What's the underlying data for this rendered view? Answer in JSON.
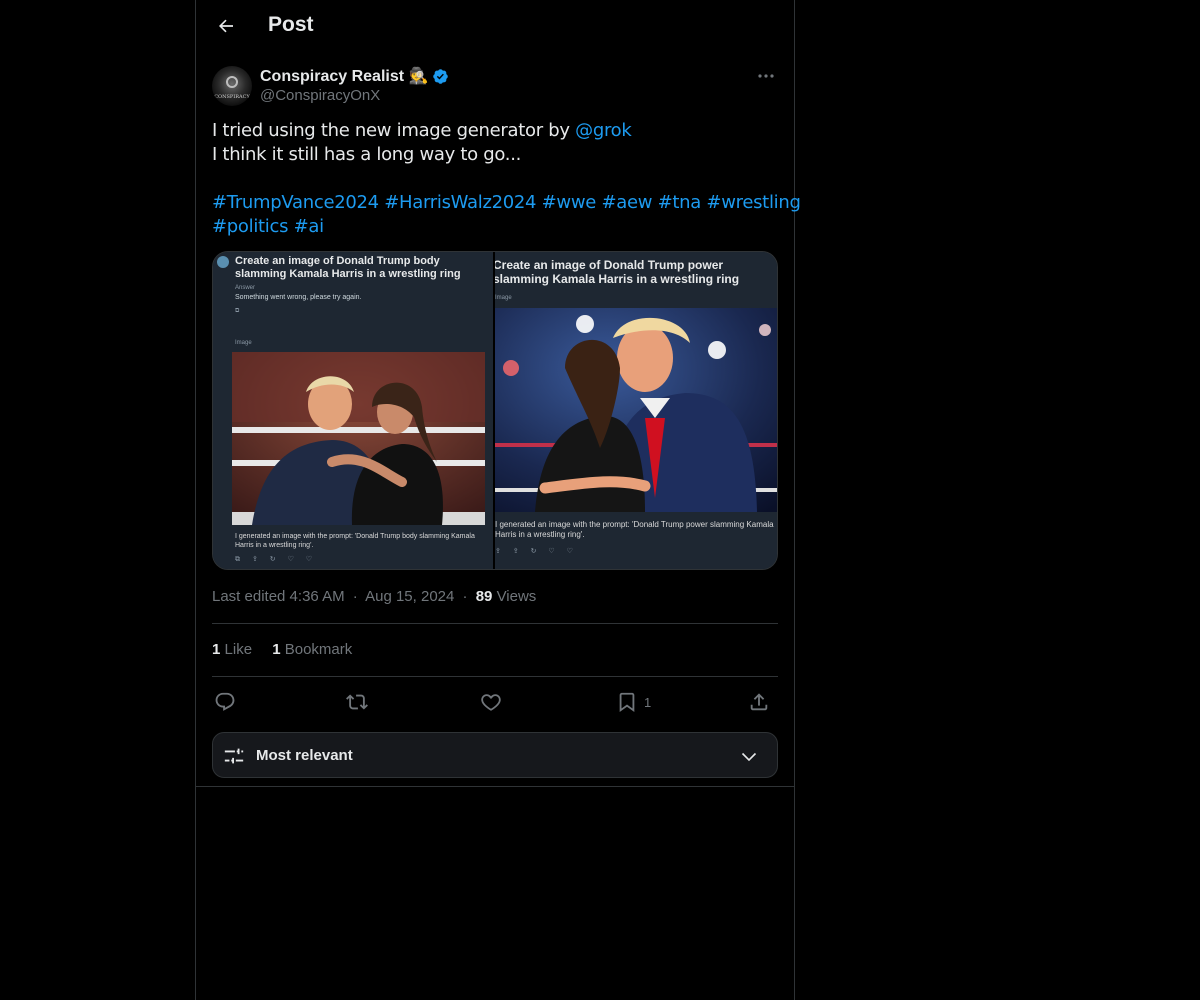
{
  "header": {
    "title": "Post"
  },
  "author": {
    "name": "Conspiracy Realist 🕵",
    "handle": "@ConspiracyOnX",
    "avatar_text": "CONSPIRACY"
  },
  "post": {
    "line1_prefix": "I tried using the new image generator by ",
    "mention": "@grok",
    "line2": "I think it still has a long way to go...",
    "hashtags_line1": [
      "#TrumpVance2024",
      "#HarrisWalz2024",
      "#wwe",
      "#aew",
      "#tna",
      "#wrestling"
    ],
    "hashtags_line2": [
      "#politics",
      "#ai"
    ]
  },
  "media": {
    "left": {
      "title": "Create an image of Donald Trump body slamming Kamala Harris in a wrestling ring",
      "answer_label": "Answer",
      "answer_text": "Something went wrong, please try again.",
      "image_label": "Image",
      "caption": "I generated an image with the prompt: 'Donald Trump body slamming Kamala Harris in a wrestling ring'."
    },
    "right": {
      "title": "Create an image of Donald Trump power slamming Kamala Harris in a wrestling ring",
      "image_label": "Image",
      "caption": "I generated an image with the prompt: 'Donald Trump power slamming Kamala Harris in a wrestling ring'."
    }
  },
  "meta": {
    "edited": "Last edited 4:36 AM",
    "separator": "·",
    "date": "Aug 15, 2024",
    "views_count": "89",
    "views_label": "Views"
  },
  "stats": {
    "likes_count": "1",
    "likes_label": "Like",
    "bookmarks_count": "1",
    "bookmarks_label": "Bookmark"
  },
  "actions": {
    "bookmark_count": "1"
  },
  "sort": {
    "label": "Most relevant"
  },
  "icons": {
    "back": "arrow-left-icon",
    "more": "more-horizontal-icon",
    "verified": "verified-badge-icon",
    "reply": "reply-icon",
    "repost": "repost-icon",
    "like": "heart-icon",
    "bookmark": "bookmark-icon",
    "share": "share-icon",
    "sort": "sliders-icon",
    "chevron": "chevron-down-icon"
  },
  "colors": {
    "background": "#000000",
    "text": "#e7e9ea",
    "muted": "#71767b",
    "accent": "#1d9bf0",
    "border": "#2f3336"
  }
}
